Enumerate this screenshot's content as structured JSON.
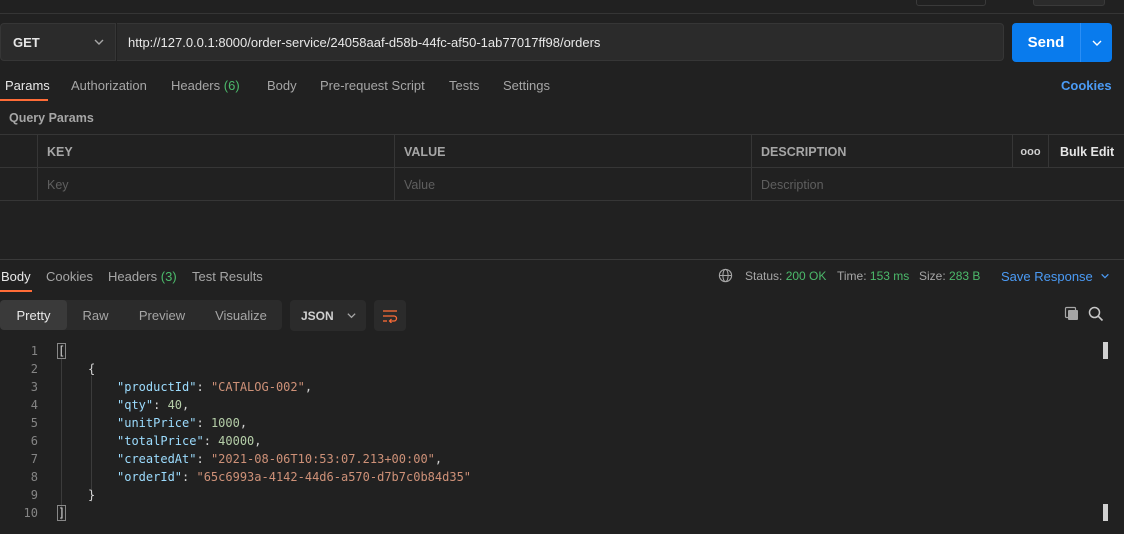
{
  "request": {
    "method": "GET",
    "url": "http://127.0.0.1:8000/order-service/24058aaf-d58b-44fc-af50-1ab77017ff98/orders",
    "send_label": "Send"
  },
  "req_tabs": {
    "params": "Params",
    "authorization": "Authorization",
    "headers": "Headers",
    "headers_count": "(6)",
    "body": "Body",
    "prerequest": "Pre-request Script",
    "tests": "Tests",
    "settings": "Settings",
    "cookies": "Cookies"
  },
  "query_params": {
    "label": "Query Params",
    "columns": {
      "key": "KEY",
      "value": "VALUE",
      "description": "DESCRIPTION",
      "more": "ooo",
      "bulk_edit": "Bulk Edit"
    },
    "placeholders": {
      "key": "Key",
      "value": "Value",
      "description": "Description"
    }
  },
  "response": {
    "tabs": {
      "body": "Body",
      "cookies": "Cookies",
      "headers": "Headers",
      "headers_count": "(3)",
      "test_results": "Test Results"
    },
    "status_label": "Status:",
    "status_value": "200 OK",
    "time_label": "Time:",
    "time_value": "153 ms",
    "size_label": "Size:",
    "size_value": "283 B",
    "save_label": "Save Response",
    "view_tabs": {
      "pretty": "Pretty",
      "raw": "Raw",
      "preview": "Preview",
      "visualize": "Visualize"
    },
    "format": "JSON"
  },
  "editor": {
    "line_numbers": [
      "1",
      "2",
      "3",
      "4",
      "5",
      "6",
      "7",
      "8",
      "9",
      "10"
    ],
    "open_bracket": "[",
    "open_brace": "{",
    "close_brace": "}",
    "close_bracket": "]",
    "fields": [
      {
        "key": "\"productId\"",
        "value": "\"CATALOG-002\"",
        "type": "string",
        "comma": ","
      },
      {
        "key": "\"qty\"",
        "value": "40",
        "type": "number",
        "comma": ","
      },
      {
        "key": "\"unitPrice\"",
        "value": "1000",
        "type": "number",
        "comma": ","
      },
      {
        "key": "\"totalPrice\"",
        "value": "40000",
        "type": "number",
        "comma": ","
      },
      {
        "key": "\"createdAt\"",
        "value": "\"2021-08-06T10:53:07.213+00:00\"",
        "type": "string",
        "comma": ","
      },
      {
        "key": "\"orderId\"",
        "value": "\"65c6993a-4142-44d6-a570-d7b7c0b84d35\"",
        "type": "string",
        "comma": ""
      }
    ]
  },
  "colors": {
    "accent_orange": "#ff6c37",
    "send_blue": "#097bed",
    "link_blue": "#4b9bf5",
    "ok_green": "#4cba6b"
  }
}
